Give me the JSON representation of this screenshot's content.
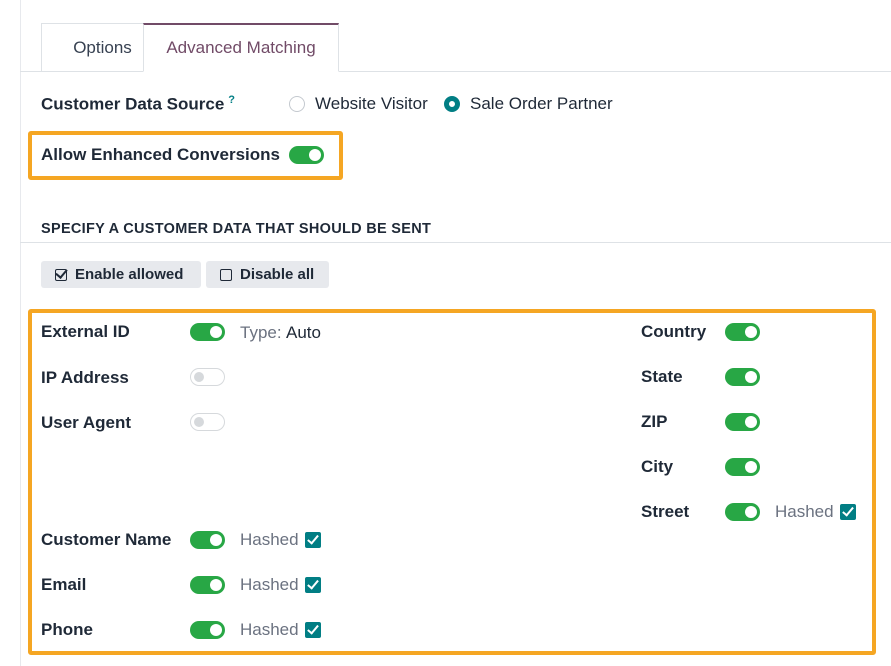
{
  "tabs": [
    {
      "label": "Options"
    },
    {
      "label": "Advanced Matching",
      "active": true
    }
  ],
  "data_source": {
    "label": "Customer Data Source",
    "help": "?",
    "options": [
      {
        "label": "Website Visitor",
        "selected": false
      },
      {
        "label": "Sale Order Partner",
        "selected": true
      }
    ]
  },
  "enhanced_conversions": {
    "label": "Allow Enhanced Conversions",
    "enabled": true
  },
  "section": {
    "title": "SPECIFY A CUSTOMER DATA THAT SHOULD BE SENT"
  },
  "buttons": {
    "enable_allowed": "Enable allowed",
    "disable_all": "Disable all"
  },
  "fields_left": [
    {
      "label": "External ID",
      "enabled": true,
      "type_label": "Type:",
      "type_value": "Auto"
    },
    {
      "label": "IP Address",
      "enabled": false
    },
    {
      "label": "User Agent",
      "enabled": false
    },
    {
      "label": "Customer Name",
      "enabled": true,
      "hashed_label": "Hashed",
      "hashed": true
    },
    {
      "label": "Email",
      "enabled": true,
      "hashed_label": "Hashed",
      "hashed": true
    },
    {
      "label": "Phone",
      "enabled": true,
      "hashed_label": "Hashed",
      "hashed": true
    }
  ],
  "fields_right": [
    {
      "label": "Country",
      "enabled": true
    },
    {
      "label": "State",
      "enabled": true
    },
    {
      "label": "ZIP",
      "enabled": true
    },
    {
      "label": "City",
      "enabled": true
    },
    {
      "label": "Street",
      "enabled": true,
      "hashed_label": "Hashed",
      "hashed": true
    }
  ],
  "colors": {
    "accent": "#017e84",
    "toggle_on": "#28a745",
    "highlight": "#f5a623",
    "tab_active": "#714b67"
  }
}
